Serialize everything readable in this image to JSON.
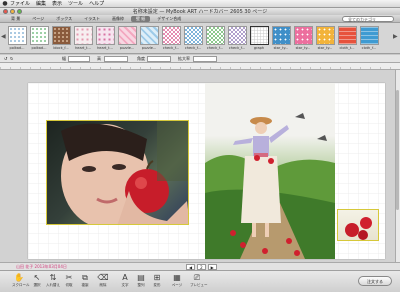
{
  "menubar": {
    "items": [
      "ファイル",
      "編集",
      "表示",
      "ツール",
      "ヘルプ"
    ]
  },
  "window": {
    "title": "名称未設定 — MyBook ART ハードカバー 2605 30 ページ"
  },
  "categories": {
    "tabs": [
      "背 景",
      "ページ",
      "ボックス",
      "イラスト",
      "画像枠",
      "壁 紙",
      "デザイン合成"
    ],
    "active_index": 5,
    "filter_value": "全てのカテゴリ"
  },
  "patterns": [
    {
      "label": "polkad...",
      "style": "dots"
    },
    {
      "label": "polkad...",
      "style": "dots2"
    },
    {
      "label": "block_f...",
      "style": "brown"
    },
    {
      "label": "heart_t...",
      "style": "hearts1"
    },
    {
      "label": "heart_t...",
      "style": "hearts2"
    },
    {
      "label": "puzzle...",
      "style": "puzzle"
    },
    {
      "label": "puzzle...",
      "style": "puzzle2"
    },
    {
      "label": "check_f...",
      "style": "chk1"
    },
    {
      "label": "check_f...",
      "style": "chk2"
    },
    {
      "label": "check_f...",
      "style": "chk3"
    },
    {
      "label": "check_f...",
      "style": "chk4"
    },
    {
      "label": "graph",
      "style": "graph"
    },
    {
      "label": "star_ty...",
      "style": "stars1"
    },
    {
      "label": "star_ty...",
      "style": "stars2"
    },
    {
      "label": "star_ty...",
      "style": "stars3"
    },
    {
      "label": "cloth_t...",
      "style": "cloth1"
    },
    {
      "label": "cloth_f...",
      "style": "cloth2"
    }
  ],
  "selected_pattern_index": 11,
  "toolbar": {
    "labels": [
      "幅",
      "高",
      "角度",
      "拡大率"
    ]
  },
  "status": {
    "date": "山田 花子  2013年03月04日",
    "page_prev": "◀",
    "page_num": "2",
    "page_next": "▶"
  },
  "tools": [
    {
      "icon": "✋",
      "label": "スクロール",
      "name": "hand-tool-icon"
    },
    {
      "icon": "↖",
      "label": "選択",
      "name": "select-tool-icon"
    },
    {
      "icon": "⇅",
      "label": "入れ替え",
      "name": "swap-tool-icon"
    },
    {
      "icon": "✂",
      "label": "切取",
      "name": "cut-tool-icon"
    },
    {
      "icon": "⧉",
      "label": "複製",
      "name": "copy-tool-icon"
    },
    {
      "icon": "⌫",
      "label": "削除",
      "name": "delete-tool-icon"
    },
    {
      "icon": "A",
      "label": "文字",
      "name": "text-tool-icon"
    },
    {
      "icon": "▤",
      "label": "整列",
      "name": "align-tool-icon"
    },
    {
      "icon": "⊞",
      "label": "変形",
      "name": "transform-tool-icon"
    },
    {
      "icon": "▦",
      "label": "ページ",
      "name": "page-tool-icon"
    },
    {
      "icon": "⎚",
      "label": "プレビュー",
      "name": "preview-tool-icon"
    }
  ],
  "order_button": "注文する",
  "colors": {
    "accent": "#d23a7a",
    "frame": "#d6c83a",
    "active_tab": "#7b7b7b"
  }
}
